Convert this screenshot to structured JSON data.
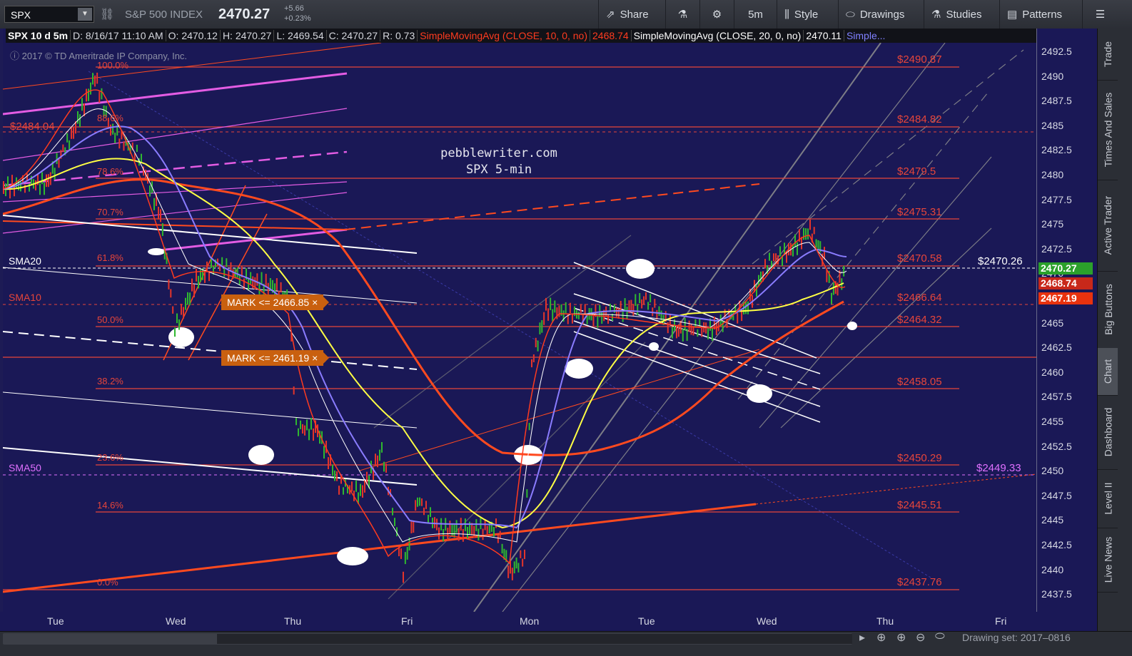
{
  "toolbar": {
    "symbol": "SPX",
    "name": "S&P 500 INDEX",
    "price": "2470.27",
    "change": "+5.66",
    "change_pct": "+0.23%",
    "buttons": {
      "share": "Share",
      "timeframe": "5m",
      "style": "Style",
      "drawings": "Drawings",
      "studies": "Studies",
      "patterns": "Patterns"
    }
  },
  "infobar": {
    "symbol": "SPX 10 d 5m",
    "date": "D: 8/16/17 11:10 AM",
    "open": "O: 2470.12",
    "high": "H: 2470.27",
    "low": "L: 2469.54",
    "close": "C: 2470.27",
    "range": "R: 0.73",
    "sma10_label": "SimpleMovingAvg (CLOSE, 10, 0, no)",
    "sma10_value": "2468.74",
    "sma20_label": "SimpleMovingAvg (CLOSE, 20, 0, no)",
    "sma20_value": "2470.11",
    "more": "Simple..."
  },
  "copyright": "2017 © TD Ameritrade IP Company, Inc.",
  "watermark": {
    "line1": "pebblewriter.com",
    "line2": "SPX 5-min"
  },
  "y_ticks": [
    "2492.5",
    "2490",
    "2487.5",
    "2485",
    "2482.5",
    "2480",
    "2477.5",
    "2475",
    "2472.5",
    "2470",
    "2467.5",
    "2465",
    "2462.5",
    "2460",
    "2457.5",
    "2455",
    "2452.5",
    "2450",
    "2447.5",
    "2445",
    "2442.5",
    "2440",
    "2437.5"
  ],
  "x_ticks": [
    "Tue",
    "Wed",
    "Thu",
    "Fri",
    "Mon",
    "Tue",
    "Wed",
    "Thu",
    "Fri"
  ],
  "fib_left": [
    "100.0%",
    "88.6%",
    "78.6%",
    "70.7%",
    "61.8%",
    "50.0%",
    "38.2%",
    "23.6%",
    "14.6%",
    "0.0%"
  ],
  "fib_right": [
    "$2490.87",
    "$2484.82",
    "$2479.5",
    "$2475.31",
    "$2470.58",
    "$2466.64",
    "$2464.32",
    "$2458.05",
    "$2450.29",
    "$2445.51",
    "$2437.76"
  ],
  "price_labels": {
    "left_2484": "$2484.04",
    "right_2470": "$2470.26",
    "right_2449": "$2449.33"
  },
  "sma_labels": {
    "sma20": "SMA20",
    "sma10": "SMA10",
    "sma50": "SMA50"
  },
  "marks": [
    "MARK <= 2466.85 ×",
    "MARK <= 2461.19 ×"
  ],
  "axis_tags": {
    "last": "2470.27",
    "sma10": "2468.74",
    "sma20b": "2467.19"
  },
  "colors": {
    "bg": "#1a1856",
    "fib": "#e6453a",
    "sma10": "#ff3b1f",
    "sma20": "#ffff44",
    "sma50": "#e070ff",
    "last_tag": "#2ba02b"
  },
  "right_tabs": [
    "Trade",
    "Times And Sales",
    "Active Trader",
    "Big Buttons",
    "Chart",
    "Dashboard",
    "Level II",
    "Live News"
  ],
  "drawing_set": "Drawing set: 2017–0816"
}
